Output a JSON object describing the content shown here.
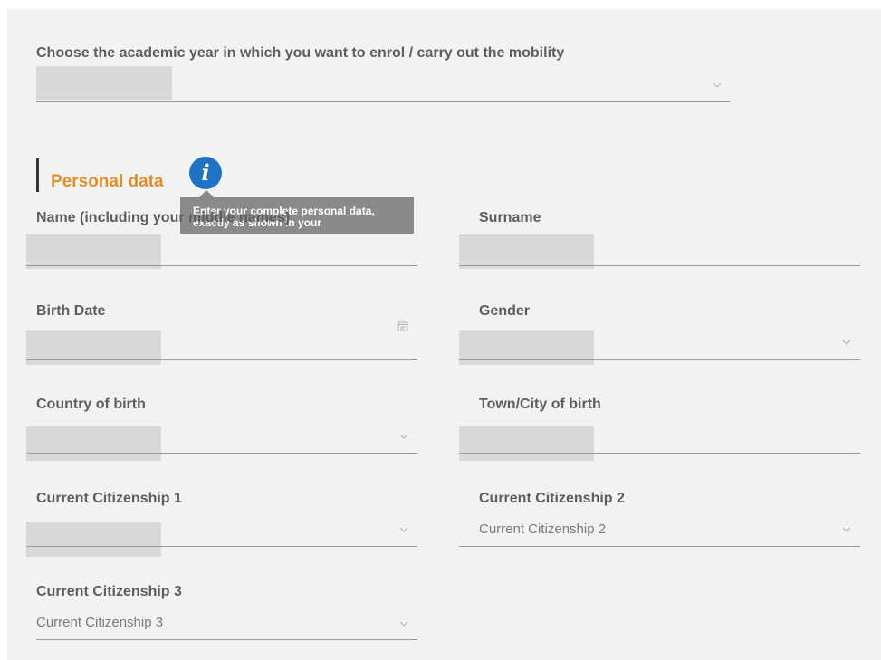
{
  "academic_year": {
    "label": "Choose the academic year in which you want to enrol / carry out the mobility"
  },
  "section": {
    "title": "Personal data",
    "info_tooltip": "Enter your complete personal data, exactly as shown in your"
  },
  "fields": {
    "name": {
      "label": "Name (including your middle names)"
    },
    "surname": {
      "label": "Surname"
    },
    "birth_date": {
      "label": "Birth Date"
    },
    "gender": {
      "label": "Gender"
    },
    "country_of_birth": {
      "label": "Country of birth"
    },
    "town_of_birth": {
      "label": "Town/City of birth"
    },
    "citizenship_1": {
      "label": "Current Citizenship 1"
    },
    "citizenship_2": {
      "label": "Current Citizenship 2",
      "placeholder": "Current Citizenship 2"
    },
    "citizenship_3": {
      "label": "Current Citizenship 3",
      "placeholder": "Current Citizenship 3"
    }
  },
  "icons": {
    "info": "info-icon",
    "calendar": "calendar-icon",
    "dropdown": "chevron-down-icon"
  },
  "colors": {
    "section_title": "#e08e2a",
    "info_icon": "#1f72c4",
    "panel_bg": "#f2f2f2",
    "tooltip_bg": "#8a8a8a"
  }
}
